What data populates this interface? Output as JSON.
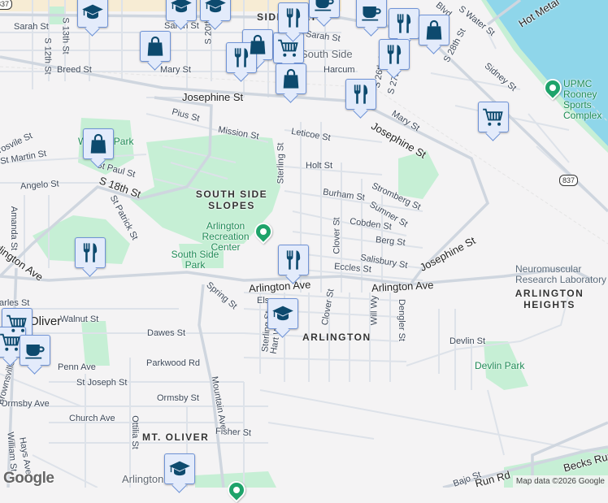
{
  "map": {
    "colors": {
      "background": "#f4f3f4",
      "road": "#d3dae2",
      "park": "#c6efd5",
      "water": "#8fd6ea",
      "marker_bg": "#e3ebfb",
      "marker_icon": "#0d4a6e",
      "poi_green": "#1ea36a"
    },
    "streets": [
      "Sarah St",
      "S 13th St",
      "S 12th St",
      "Breed St",
      "Mary St",
      "S 20th St",
      "Sarah St",
      "Sarah St",
      "Josephine St",
      "Pius St",
      "Mission St",
      "Leticoe St",
      "Sterling St",
      "Holt St",
      "Burham St",
      "Stromberg St",
      "Sumner St",
      "Cobden St",
      "Berg St",
      "Clover St",
      "Salisbury St",
      "Eccles St",
      "Josephine St",
      "Josephine St",
      "Mary St",
      "S 27th St",
      "S 28th St",
      "S Water St",
      "Hot Metal",
      "Sidney St",
      "Harcum",
      "St Martin St",
      "St Paul St",
      "S 18th St",
      "Angelo St",
      "St Patrick St",
      "Amanda St",
      "Arlington Ave",
      "Arlington Ave",
      "Arlington Ave",
      "Spring St",
      "Charles St",
      "Walnut St",
      "Dawes St",
      "Penn Ave",
      "Parkwood Rd",
      "St Joseph St",
      "Ormsby Ave",
      "Ormsby St",
      "Church Ave",
      "Ottilia St",
      "Mountain Ave",
      "Fisher St",
      "Hays Ave",
      "William St",
      "Brownsville",
      "Devlin St",
      "Dengler St",
      "Will Wy",
      "Clover St",
      "Sterling St",
      "Hart Wy",
      "Becks Run Rd",
      "Run Rd",
      "Bajo St",
      "Els",
      "S 26th St",
      "Blvd",
      "Grosvile St"
    ],
    "areas": [
      "SOUTH SIDE SLOPES",
      "ARLINGTON",
      "ARLINGTON HEIGHTS",
      "MT. OLIVER",
      "SIDE FLATS"
    ],
    "places": [
      "South Side",
      "Oliver",
      "Arlington"
    ],
    "parks": [
      "Arlington Recreation Center",
      "South Side Park",
      "Devlin Park",
      "Wrights Park",
      "UPMC Rooney Sports Complex"
    ],
    "poi_labels": [
      "Neuromuscular Research Laboratory"
    ],
    "route_shield": "837",
    "markers": [
      {
        "type": "school",
        "icon": "graduation-cap-icon"
      },
      {
        "type": "shopping",
        "icon": "shopping-bag-icon"
      },
      {
        "type": "restaurant",
        "icon": "fork-knife-icon"
      },
      {
        "type": "shopping",
        "icon": "shopping-bag-icon"
      },
      {
        "type": "grocery",
        "icon": "shopping-cart-icon"
      },
      {
        "type": "shopping",
        "icon": "shopping-bag-icon"
      },
      {
        "type": "restaurant",
        "icon": "fork-knife-icon"
      },
      {
        "type": "school",
        "icon": "graduation-cap-icon"
      },
      {
        "type": "school",
        "icon": "graduation-cap-icon"
      },
      {
        "type": "cafe",
        "icon": "coffee-cup-icon"
      },
      {
        "type": "cafe",
        "icon": "coffee-cup-icon"
      },
      {
        "type": "restaurant",
        "icon": "fork-knife-icon"
      },
      {
        "type": "shopping",
        "icon": "shopping-bag-icon"
      },
      {
        "type": "restaurant",
        "icon": "fork-knife-icon"
      },
      {
        "type": "restaurant",
        "icon": "fork-knife-icon"
      },
      {
        "type": "grocery",
        "icon": "shopping-cart-icon"
      },
      {
        "type": "shopping",
        "icon": "shopping-bag-icon"
      },
      {
        "type": "restaurant",
        "icon": "fork-knife-icon"
      },
      {
        "type": "restaurant",
        "icon": "fork-knife-icon"
      },
      {
        "type": "school",
        "icon": "graduation-cap-icon"
      },
      {
        "type": "grocery",
        "icon": "shopping-cart-icon"
      },
      {
        "type": "grocery",
        "icon": "shopping-cart-icon"
      },
      {
        "type": "cafe",
        "icon": "coffee-cup-icon"
      },
      {
        "type": "school",
        "icon": "graduation-cap-icon"
      }
    ],
    "logo": "Google",
    "attribution": "Map data ©2026 Google"
  }
}
